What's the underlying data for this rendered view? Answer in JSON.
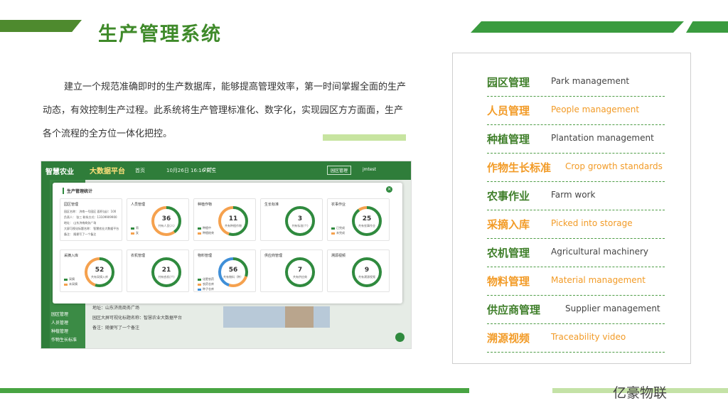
{
  "title": "生产管理系统",
  "intro": "建立一个规范准确即时的生产数据库，能够提高管理效率，第一时间掌握全面的生产动态，有效控制生产过程。此系统将生产管理标准化、数字化，实现园区方方面面，生产各个流程的全方位一体化把控。",
  "brand": "亿豪物联",
  "list": [
    {
      "zh": "园区管理",
      "en": "Park management",
      "color": "green"
    },
    {
      "zh": "人员管理",
      "en": "People management",
      "color": "orange"
    },
    {
      "zh": "种植管理",
      "en": "Plantation management",
      "color": "green"
    },
    {
      "zh": "作物生长标准",
      "en": "Crop growth standards",
      "color": "orange"
    },
    {
      "zh": "农事作业",
      "en": "Farm work",
      "color": "green"
    },
    {
      "zh": "采摘入库",
      "en": "Picked into storage",
      "color": "orange"
    },
    {
      "zh": "农机管理",
      "en": "Agricultural machinery",
      "color": "green"
    },
    {
      "zh": "物料管理",
      "en": "Material management",
      "color": "orange"
    },
    {
      "zh": "供应商管理",
      "en": "Supplier management",
      "color": "green"
    },
    {
      "zh": "溯源视频",
      "en": "Traceability video",
      "color": "orange"
    }
  ],
  "app": {
    "logo": "智慧农业",
    "platform": "大数据平台",
    "home": "首页",
    "date": "10月26日 16:16  周三",
    "weather": "20°C",
    "park_btn": "园区管理",
    "user": "jmtest",
    "side": [
      "园区管理",
      "人员管理",
      "种植管理",
      "作物生长标准"
    ],
    "info": [
      "地址：山东济南商务广场",
      "园区大屏可视化标题名称：智慧农业大数据平台",
      "备注：随便写了一个备注"
    ],
    "modal_title": "生产管理统计",
    "park": {
      "title": "园区管理",
      "lines": [
        "园区名称： 济南一号园区   面积(亩)：100",
        "负责人： 张三     联系方式：13109909900",
        "地址： 山东济南商务广场",
        "大屏可视化标题名称： 智慧农业大数据平台",
        "备注： 随便写了一个备注"
      ]
    },
    "cards": [
      {
        "title": "人员管理",
        "value": "36",
        "sub": "共有人员(人)",
        "legend": [
          "男",
          "女"
        ],
        "fracs": [
          0.4,
          0.6
        ],
        "colors": [
          "#2f8a3e",
          "#f5a14e"
        ]
      },
      {
        "title": "种植作物",
        "value": "11",
        "sub": "共有种植作物",
        "legend": [
          "种植中",
          "种植结束"
        ],
        "fracs": [
          0.55,
          0.45
        ],
        "colors": [
          "#2f8a3e",
          "#f5a14e"
        ]
      },
      {
        "title": "生长标准",
        "value": "3",
        "sub": "共有标准(个)",
        "legend": [],
        "fracs": [
          1
        ],
        "colors": [
          "#2f8a3e"
        ]
      },
      {
        "title": "农事作业",
        "value": "25",
        "sub": "共有农事作业",
        "legend": [
          "已完成",
          "未完成"
        ],
        "fracs": [
          0.9,
          0.1
        ],
        "colors": [
          "#2f8a3e",
          "#f5a14e"
        ]
      },
      {
        "title": "采摘入库",
        "value": "52",
        "sub": "共有采摘入库",
        "legend": [
          "采摘",
          "未采摘"
        ],
        "fracs": [
          0.55,
          0.45
        ],
        "colors": [
          "#2f8a3e",
          "#f5a14e"
        ]
      },
      {
        "title": "农机管理",
        "value": "21",
        "sub": "共有农机(个)",
        "legend": [],
        "fracs": [
          1
        ],
        "colors": [
          "#2f8a3e"
        ]
      },
      {
        "title": "物料管理",
        "value": "56",
        "sub": "共有物料（种）",
        "legend": [
          "化肥农药",
          "农药仓库",
          "种子仓库"
        ],
        "fracs": [
          0.3,
          0.25,
          0.45
        ],
        "colors": [
          "#2f8a3e",
          "#f5a14e",
          "#3f8fd8"
        ]
      },
      {
        "title": "供应商管理",
        "value": "7",
        "sub": "共有供应商",
        "legend": [],
        "fracs": [
          1
        ],
        "colors": [
          "#2f8a3e"
        ]
      },
      {
        "title": "溯源视频",
        "value": "9",
        "sub": "共有溯源视频",
        "legend": [],
        "fracs": [
          1
        ],
        "colors": [
          "#2f8a3e"
        ]
      }
    ]
  }
}
